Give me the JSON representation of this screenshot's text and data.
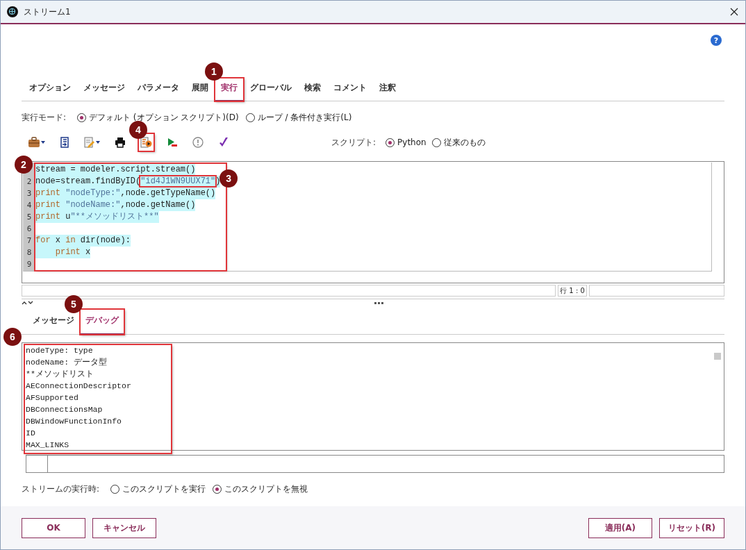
{
  "window": {
    "title": "ストリーム1"
  },
  "help": "?",
  "tabs": [
    {
      "label": "オプション",
      "selected": false
    },
    {
      "label": "メッセージ",
      "selected": false
    },
    {
      "label": "パラメータ",
      "selected": false
    },
    {
      "label": "展開",
      "selected": false
    },
    {
      "label": "実行",
      "selected": true,
      "callout": "1"
    },
    {
      "label": "グローバル",
      "selected": false
    },
    {
      "label": "検索",
      "selected": false
    },
    {
      "label": "コメント",
      "selected": false
    },
    {
      "label": "注釈",
      "selected": false
    }
  ],
  "execution_mode": {
    "label": "実行モード:",
    "options": [
      {
        "label": "デフォルト (オプション スクリプト)(D)",
        "selected": true
      },
      {
        "label": "ループ / 条件付き実行(L)",
        "selected": false
      }
    ]
  },
  "toolbar": [
    {
      "kind": "briefcase",
      "dropdown": true
    },
    {
      "kind": "import",
      "dropdown": false
    },
    {
      "kind": "edit",
      "dropdown": true
    },
    {
      "kind": "print",
      "dropdown": false
    },
    {
      "kind": "run-selection",
      "dropdown": false,
      "callout": "4"
    },
    {
      "kind": "run",
      "dropdown": false
    },
    {
      "kind": "check",
      "dropdown": false
    },
    {
      "kind": "tick",
      "dropdown": false
    }
  ],
  "script_type": {
    "label": "スクリプト:",
    "options": [
      {
        "label": "Python",
        "selected": true
      },
      {
        "label": "従来のもの",
        "selected": false
      }
    ]
  },
  "editor": {
    "callout": "2",
    "lines": [
      {
        "selected": true,
        "tokens": [
          {
            "kind": "plain",
            "text": "stream = modeler.script.stream()"
          }
        ]
      },
      {
        "number": "2",
        "selected": true,
        "tokens": [
          {
            "kind": "plain",
            "text": "node=stream.findByID("
          },
          {
            "kind": "string",
            "text": "\"id4J1WN9UUX71\"",
            "callout": "3"
          },
          {
            "kind": "plain",
            "text": ")"
          }
        ]
      },
      {
        "number": "3",
        "selected": true,
        "tokens": [
          {
            "kind": "keyword",
            "text": "print"
          },
          {
            "kind": "string",
            "text": " \"nodeType:\""
          },
          {
            "kind": "plain",
            "text": ",node.getTypeName()"
          }
        ]
      },
      {
        "number": "4",
        "selected": true,
        "tokens": [
          {
            "kind": "keyword",
            "text": "print"
          },
          {
            "kind": "string",
            "text": " \"nodeName:\""
          },
          {
            "kind": "plain",
            "text": ",node.getName()"
          }
        ]
      },
      {
        "number": "5",
        "selected": true,
        "tokens": [
          {
            "kind": "keyword",
            "text": "print"
          },
          {
            "kind": "plain",
            "text": " u"
          },
          {
            "kind": "string",
            "text": "\"**メソッドリスト**\""
          }
        ]
      },
      {
        "number": "6"
      },
      {
        "number": "7",
        "selected": true,
        "tokens": [
          {
            "kind": "keyword",
            "text": "for"
          },
          {
            "kind": "plain",
            "text": " x "
          },
          {
            "kind": "keyword",
            "text": "in"
          },
          {
            "kind": "plain",
            "text": " dir(node):"
          }
        ]
      },
      {
        "number": "8",
        "selected": true,
        "indented": true,
        "tokens": [
          {
            "kind": "keyword",
            "text": "print"
          },
          {
            "kind": "plain",
            "text": " x"
          }
        ]
      },
      {
        "number": "9"
      }
    ]
  },
  "status": {
    "position": "行 1 : 0"
  },
  "output_tabs": [
    {
      "label": "メッセージ",
      "selected": false
    },
    {
      "label": "デバッグ",
      "selected": true,
      "callout": "5"
    }
  ],
  "output": {
    "callout": "6",
    "lines": [
      "nodeType: type",
      "nodeName: データ型",
      "**メソッドリスト",
      "AEConnectionDescriptor",
      "AFSupported",
      "DBConnectionsMap",
      "DBWindowFunctionInfo",
      "ID",
      "MAX_LINKS"
    ]
  },
  "on_stream_run": {
    "label": "ストリームの実行時:",
    "options": [
      {
        "label": "このスクリプトを実行",
        "selected": false
      },
      {
        "label": "このスクリプトを無視",
        "selected": true
      }
    ]
  },
  "buttons_left": [
    "OK",
    "キャンセル"
  ],
  "buttons_right": [
    "適用(A)",
    "リセット(R)"
  ]
}
